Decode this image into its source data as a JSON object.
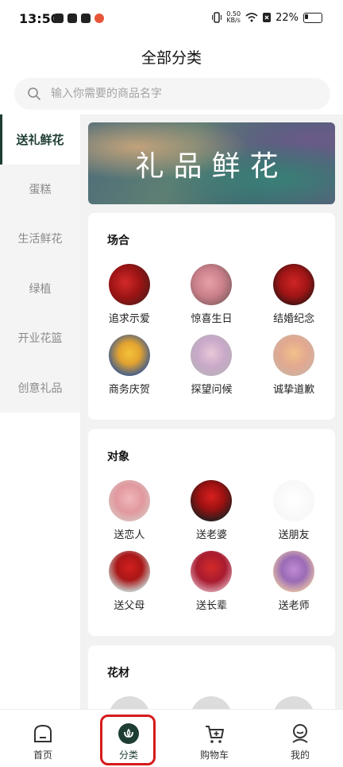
{
  "status": {
    "time": "13:50",
    "net_speed_value": "0.50",
    "net_speed_unit": "KB/s",
    "battery": "22%"
  },
  "header": {
    "title": "全部分类",
    "search_placeholder": "输入你需要的商品名字"
  },
  "sidebar": {
    "items": [
      {
        "label": "送礼鲜花",
        "active": true
      },
      {
        "label": "蛋糕"
      },
      {
        "label": "生活鲜花"
      },
      {
        "label": "绿植"
      },
      {
        "label": "开业花篮"
      },
      {
        "label": "创意礼品"
      }
    ]
  },
  "banner": {
    "text": "礼品鲜花"
  },
  "sections": [
    {
      "title": "场合",
      "items": [
        "追求示爱",
        "惊喜生日",
        "结婚纪念",
        "商务庆贺",
        "探望问候",
        "诚挚道歉"
      ]
    },
    {
      "title": "对象",
      "items": [
        "送恋人",
        "送老婆",
        "送朋友",
        "送父母",
        "送长辈",
        "送老师"
      ]
    },
    {
      "title": "花材"
    }
  ],
  "tabbar": {
    "items": [
      {
        "label": "首页",
        "icon": "home-icon"
      },
      {
        "label": "分类",
        "icon": "category-icon",
        "active": true
      },
      {
        "label": "购物车",
        "icon": "cart-icon"
      },
      {
        "label": "我的",
        "icon": "profile-icon"
      }
    ]
  },
  "colors": {
    "accent": "#1e3d33",
    "highlight": "#d61b1b"
  }
}
